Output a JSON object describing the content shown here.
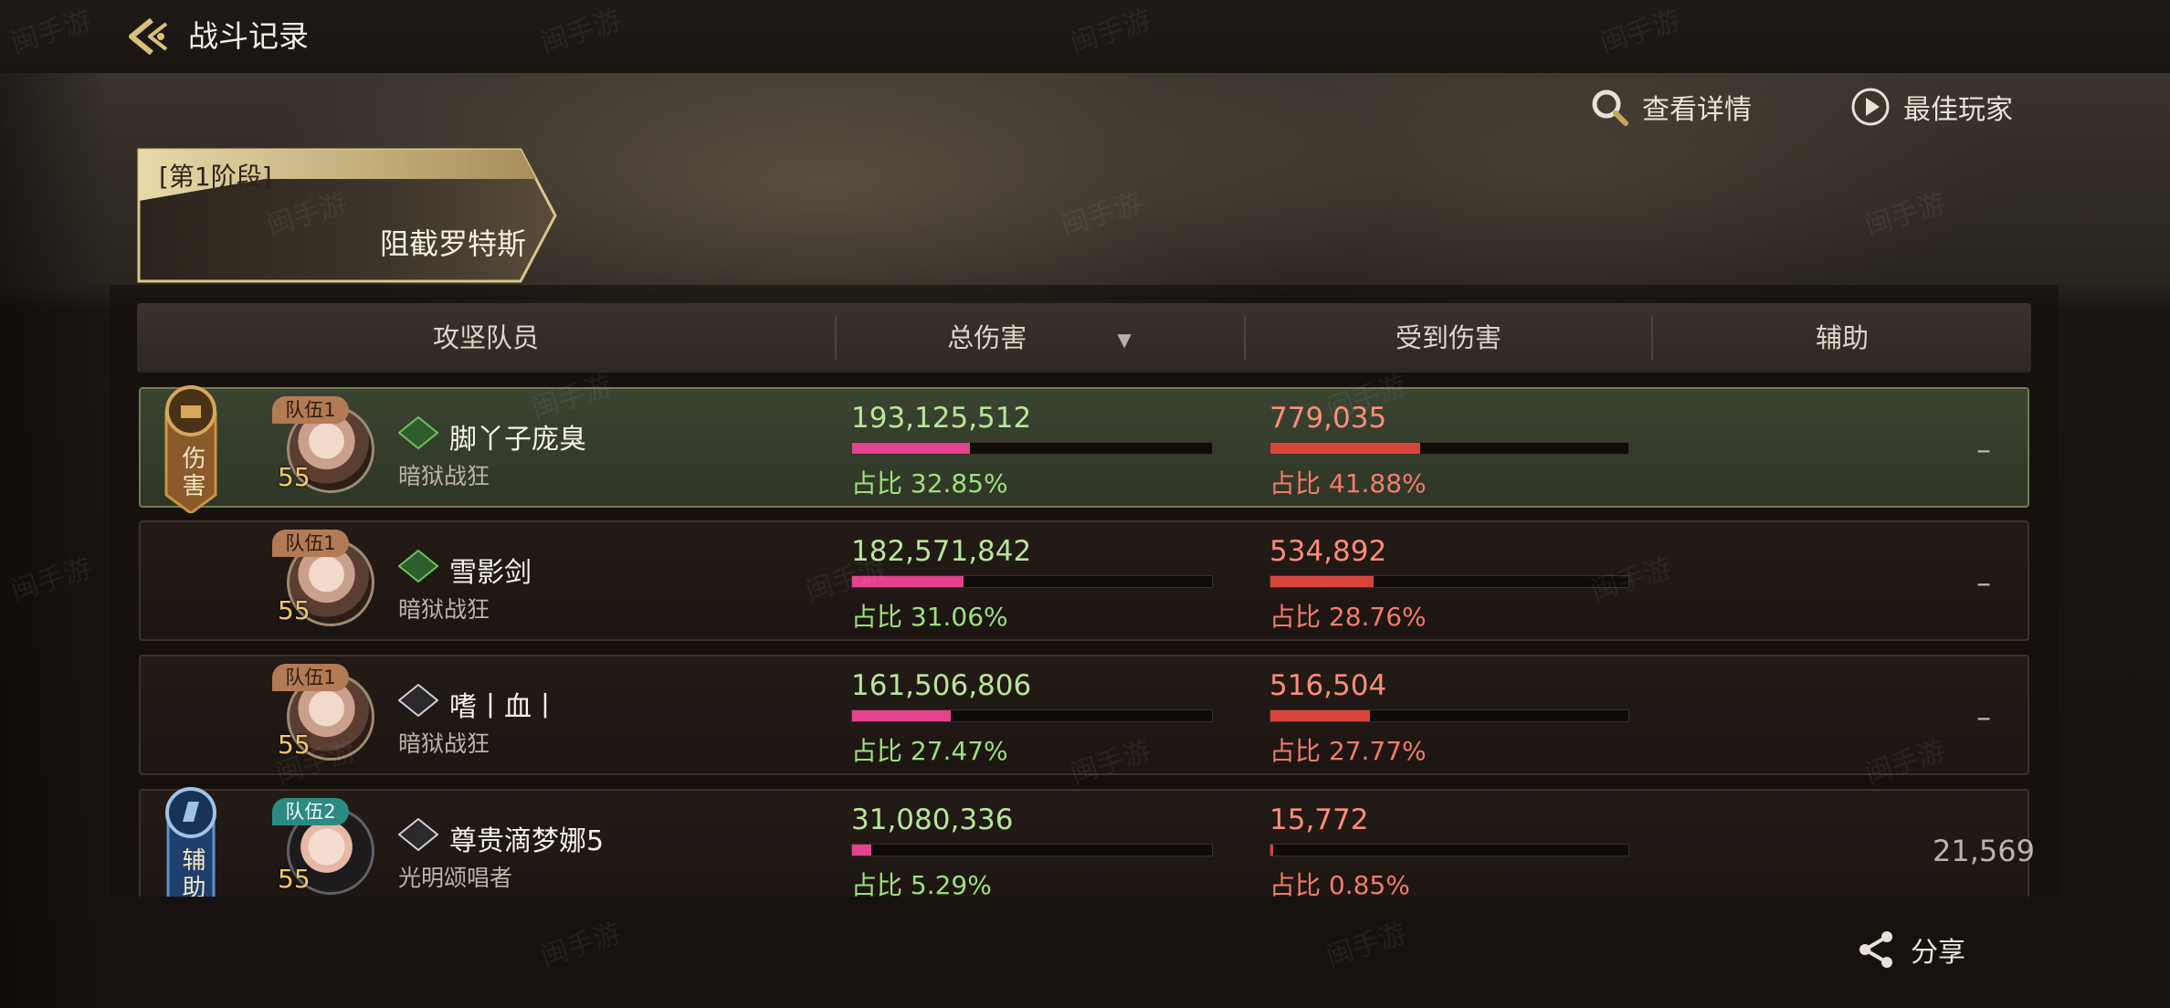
{
  "header": {
    "title": "战斗记录"
  },
  "actions": {
    "view_details": "查看详情",
    "best_player": "最佳玩家",
    "share": "分享"
  },
  "phase": {
    "label": "[第1阶段]",
    "name": "阻截罗特斯"
  },
  "table": {
    "columns": [
      "攻坚队员",
      "总伤害",
      "受到伤害",
      "辅助"
    ],
    "sort_indicator": "▼",
    "rows": [
      {
        "team": "队伍1",
        "level": "55",
        "tag": "普通",
        "name": "脚丫子庞臭",
        "class": "暗狱战狂",
        "role": "伤害",
        "damage": "193,125,512",
        "damage_pct": "占比 32.85%",
        "damage_ratio": 0.3285,
        "received": "779,035",
        "received_pct": "占比 41.88%",
        "received_ratio": 0.4188,
        "assist": "–"
      },
      {
        "team": "队伍1",
        "level": "55",
        "tag": "普通",
        "name": "雪影剑",
        "class": "暗狱战狂",
        "role": "",
        "damage": "182,571,842",
        "damage_pct": "占比 31.06%",
        "damage_ratio": 0.3106,
        "received": "534,892",
        "received_pct": "占比 28.76%",
        "received_ratio": 0.2876,
        "assist": "–"
      },
      {
        "team": "队伍1",
        "level": "55",
        "tag": "新人",
        "name": "嗜丨血丨",
        "class": "暗狱战狂",
        "role": "",
        "damage": "161,506,806",
        "damage_pct": "占比 27.47%",
        "damage_ratio": 0.2747,
        "received": "516,504",
        "received_pct": "占比 27.77%",
        "received_ratio": 0.2777,
        "assist": "–"
      },
      {
        "team": "队伍2",
        "level": "55",
        "tag": "新人",
        "name": "尊贵滴梦娜5",
        "class": "光明颂唱者",
        "role": "辅助",
        "damage": "31,080,336",
        "damage_pct": "占比 5.29%",
        "damage_ratio": 0.0529,
        "received": "15,772",
        "received_pct": "占比 0.85%",
        "received_ratio": 0.0085,
        "assist": "21,569"
      }
    ]
  },
  "watermark": "闽手游",
  "colors": {
    "damage": "#e4418f",
    "received": "#d9443a",
    "gold": "#d8bf7a",
    "top_row": "#3a4430"
  }
}
